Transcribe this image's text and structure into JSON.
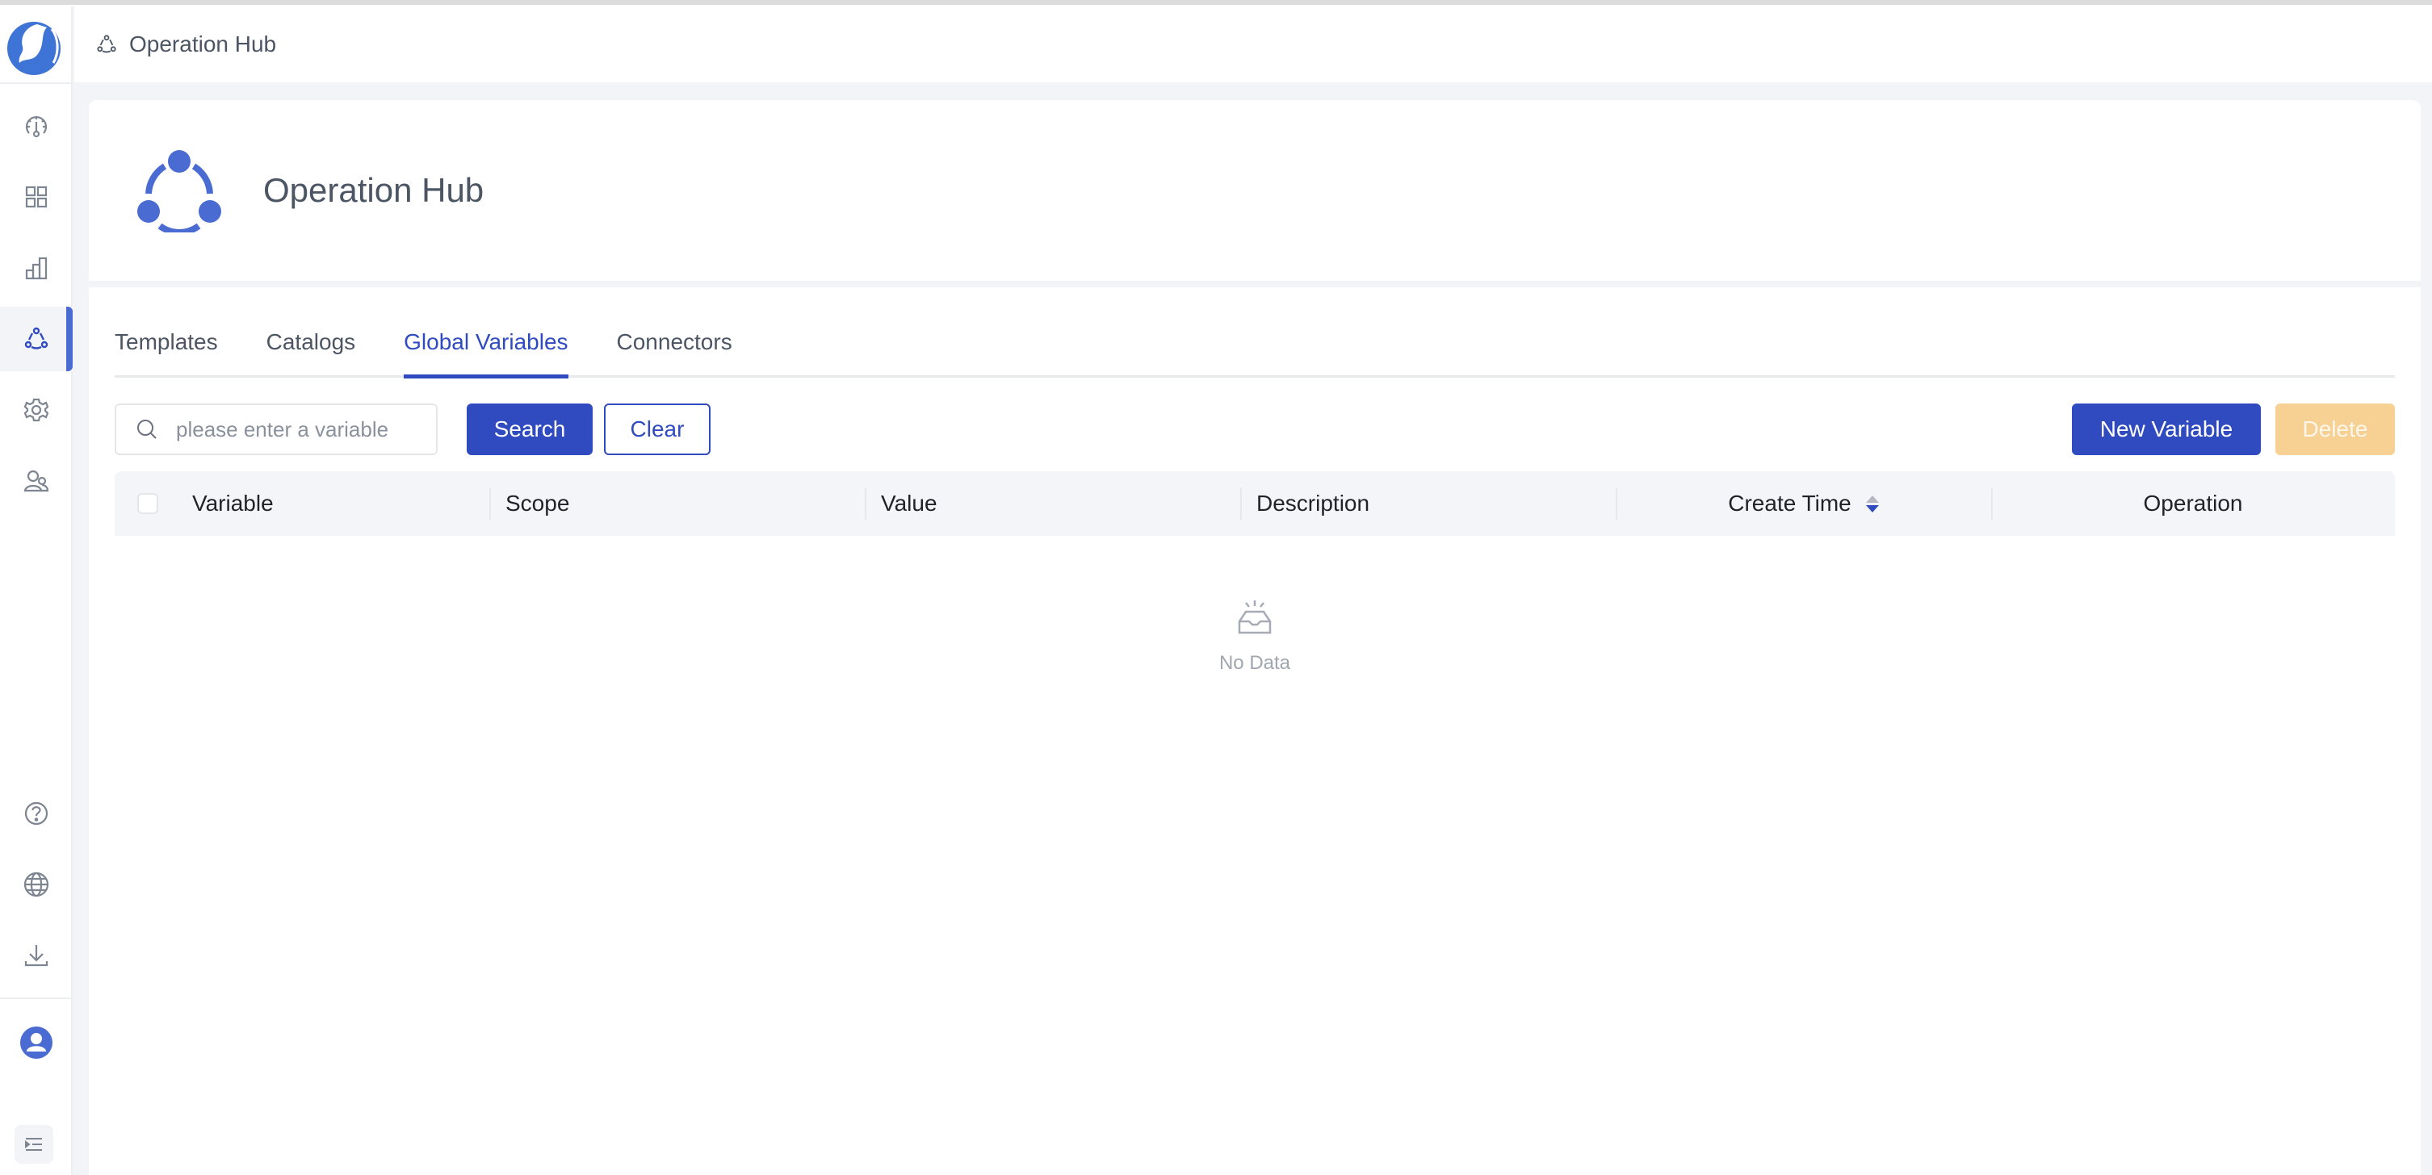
{
  "app": {
    "logo": "app-logo",
    "sidebar": {
      "items": [
        {
          "name": "dashboard",
          "icon": "gauge-icon",
          "active": false
        },
        {
          "name": "applications",
          "icon": "grid-icon",
          "active": false
        },
        {
          "name": "metrics",
          "icon": "bar-chart-icon",
          "active": false
        },
        {
          "name": "operation-hub",
          "icon": "hub-icon",
          "active": true
        },
        {
          "name": "settings",
          "icon": "gear-icon",
          "active": false
        },
        {
          "name": "users",
          "icon": "users-icon",
          "active": false
        }
      ],
      "bottom_items": [
        {
          "name": "help",
          "icon": "help-icon"
        },
        {
          "name": "language",
          "icon": "globe-icon"
        },
        {
          "name": "download",
          "icon": "download-icon"
        }
      ],
      "user": {
        "icon": "user-avatar-icon"
      },
      "collapse": {
        "icon": "collapse-menu-icon"
      }
    }
  },
  "topbar": {
    "breadcrumb": "Operation Hub"
  },
  "header": {
    "title": "Operation Hub"
  },
  "tabs": [
    {
      "label": "Templates",
      "active": false
    },
    {
      "label": "Catalogs",
      "active": false
    },
    {
      "label": "Global Variables",
      "active": true
    },
    {
      "label": "Connectors",
      "active": false
    }
  ],
  "toolbar": {
    "search_placeholder": "please enter a variable",
    "search_value": "",
    "search_label": "Search",
    "clear_label": "Clear",
    "new_label": "New Variable",
    "delete_label": "Delete"
  },
  "table": {
    "columns": [
      "Variable",
      "Scope",
      "Value",
      "Description",
      "Create Time",
      "Operation"
    ],
    "sort": {
      "column": "Create Time",
      "direction": "descending"
    },
    "rows": [],
    "empty_text": "No Data"
  },
  "colors": {
    "primary": "#2f4bbf",
    "accent_icon": "#4a6bd1",
    "delete_disabled": "#f7d194",
    "text": "#4b5563",
    "background": "#f3f4f8"
  }
}
